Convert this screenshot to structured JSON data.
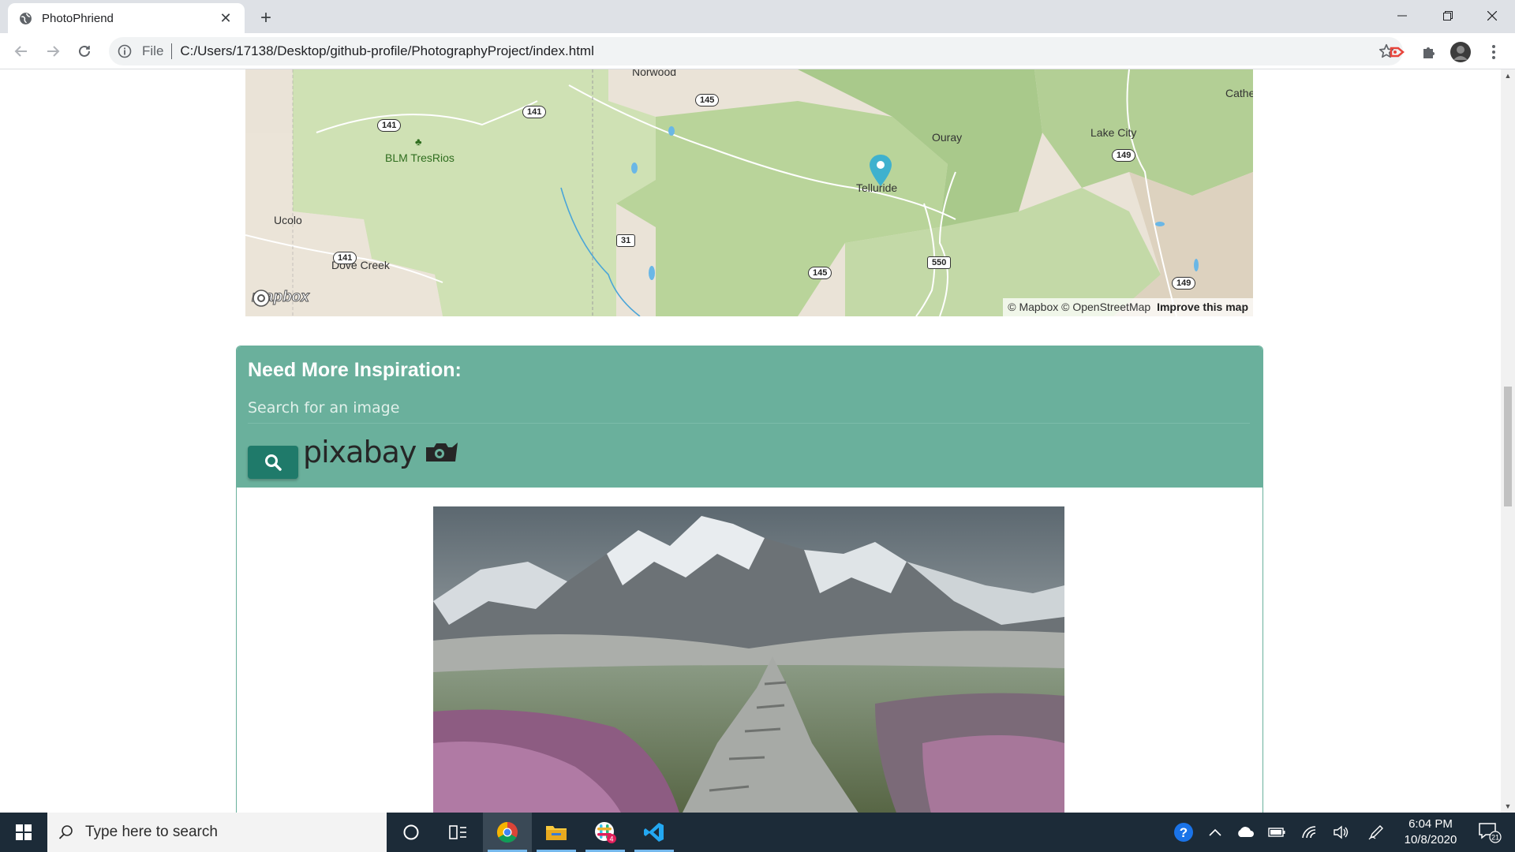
{
  "browser": {
    "tab_title": "PhotoPhriend",
    "scheme_label": "File",
    "url": "C:/Users/17138/Desktop/github-profile/PhotographyProject/index.html"
  },
  "map": {
    "labels": {
      "norwood": "Norwood",
      "blm": "BLM TresRios",
      "ucolo": "Ucolo",
      "dove_creek": "Dove Creek",
      "ouray": "Ouray",
      "telluride": "Telluride",
      "lake_city": "Lake City",
      "cathe": "Cathe"
    },
    "shields": {
      "r141a": "141",
      "r141b": "141",
      "r141c": "141",
      "r145a": "145",
      "r145b": "145",
      "r31": "31",
      "r550": "550",
      "r149a": "149",
      "r149b": "149"
    },
    "logo": "mapbox",
    "attribution": "© Mapbox © OpenStreetMap",
    "improve_link": "Improve this map"
  },
  "inspiration": {
    "title": "Need More Inspiration:",
    "search_placeholder": "Search for an image",
    "pixabay_label": "pixabay"
  },
  "taskbar": {
    "search_placeholder": "Type here to search",
    "time": "6:04 PM",
    "date": "10/8/2020",
    "chrome_badge": "4",
    "notification_count": "21"
  }
}
